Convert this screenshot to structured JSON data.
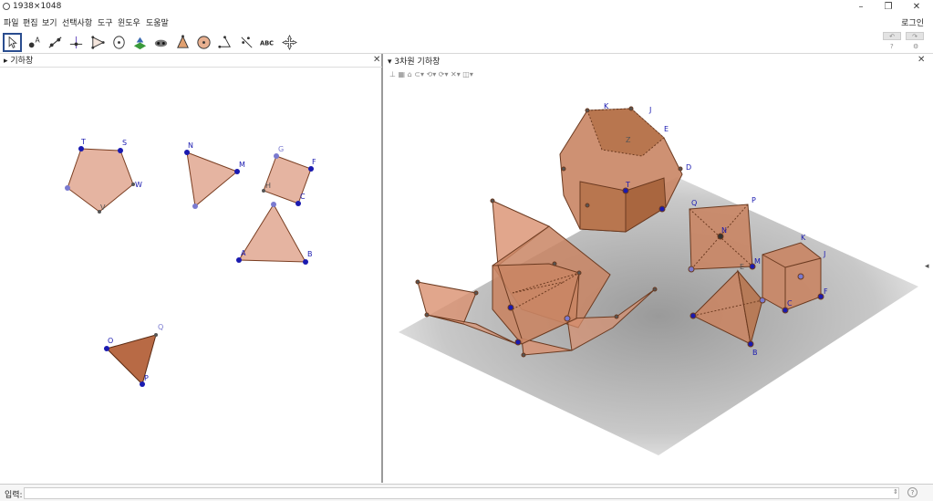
{
  "window": {
    "title": "1938×1048",
    "login": "로그인",
    "minimize_glyph": "–",
    "restore_glyph": "❐",
    "close_glyph": "✕"
  },
  "menu": [
    "파일",
    "편집",
    "보기",
    "선택사항",
    "도구",
    "윈도우",
    "도움말"
  ],
  "toolbar": {
    "tools": [
      "move-tool-icon",
      "point-tool-icon",
      "line-tool-icon",
      "perpendicular-tool-icon",
      "polygon-tool-icon",
      "circle-tool-icon",
      "plane-tool-icon",
      "intersect-tool-icon",
      "pyramid-tool-icon",
      "sphere-tool-icon",
      "angle-tool-icon",
      "reflect-tool-icon",
      "text-tool-icon",
      "move-graphics-icon"
    ],
    "text_tool_label": "ABC",
    "undo_glyph": "↶",
    "redo_glyph": "↷",
    "help_glyph": "?",
    "settings_glyph": "⚙"
  },
  "left_panel": {
    "title": "기하창",
    "close_glyph": "✕"
  },
  "right_panel": {
    "title": "3차원 기하창",
    "close_glyph": "✕",
    "side_arrow": "◂",
    "header_arrow": "▾"
  },
  "input": {
    "label": "입력:",
    "value": "",
    "help_glyph": "?"
  },
  "geometry_labels": {
    "pentagon": [
      "T",
      "S",
      "W",
      "V"
    ],
    "triangle_nm": [
      "N",
      "M"
    ],
    "square": [
      "G",
      "F",
      "H",
      "C"
    ],
    "triangle_abc": [
      "A",
      "B"
    ],
    "triangle_o": [
      "O",
      "Q",
      "P"
    ],
    "dodeca": [
      "K",
      "J",
      "E",
      "D",
      "Z",
      "T"
    ],
    "octa": [
      "Q",
      "P",
      "N",
      "M"
    ],
    "cube": [
      "K",
      "J",
      "F",
      "C"
    ],
    "tetra": [
      "E",
      "B"
    ]
  },
  "colors": {
    "face": "#d9906f",
    "edge": "#7a3e22",
    "point": "#1a1ab0",
    "selected_border": "#2a4d8f"
  }
}
